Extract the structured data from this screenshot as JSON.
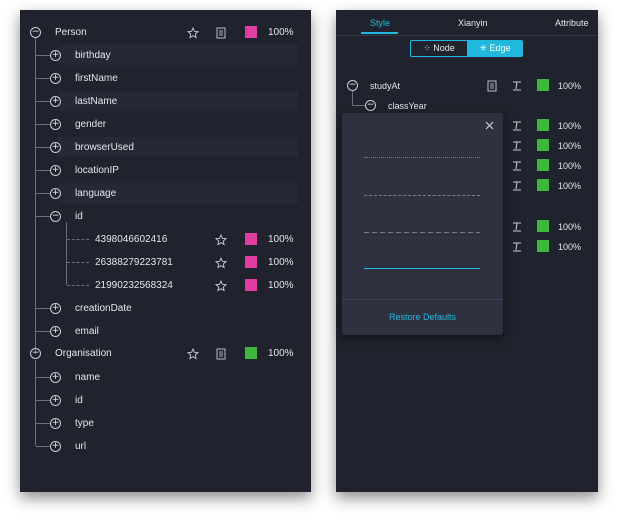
{
  "colors": {
    "accent": "#20b8dd",
    "pink": "#e13ea3",
    "green": "#3eb83c"
  },
  "left_tree": {
    "person": {
      "label": "Person",
      "percent": "100%",
      "color": "#e13ea3",
      "icons": [
        "star-icon",
        "document-icon"
      ]
    },
    "person_children": [
      "birthday",
      "firstName",
      "lastName",
      "gender",
      "browserUsed",
      "locationIP",
      "language",
      "id"
    ],
    "id_values": [
      {
        "value": "4398046602416",
        "percent": "100%",
        "color": "#e13ea3"
      },
      {
        "value": "26388279223781",
        "percent": "100%",
        "color": "#e13ea3"
      },
      {
        "value": "21990232568324",
        "percent": "100%",
        "color": "#e13ea3"
      }
    ],
    "person_children_after": [
      "creationDate",
      "email"
    ],
    "organisation": {
      "label": "Organisation",
      "percent": "100%",
      "color": "#3eb83c"
    },
    "organisation_children": [
      "name",
      "id",
      "type",
      "url"
    ]
  },
  "right_panel": {
    "tabs": [
      "Style",
      "Xianyin",
      "Attribute"
    ],
    "active_tab": "Style",
    "toggle": {
      "node_label": "Node",
      "edge_label": "Edge",
      "active": "Edge"
    },
    "edge_tree": {
      "root": {
        "label": "studyAt",
        "percent": "100%",
        "color": "#3eb83c"
      },
      "child": {
        "label": "classYear"
      },
      "rows": [
        {
          "percent": "100%",
          "color": "#3eb83c"
        },
        {
          "percent": "100%",
          "color": "#3eb83c"
        },
        {
          "percent": "100%",
          "color": "#3eb83c"
        },
        {
          "percent": "100%",
          "color": "#3eb83c"
        },
        {
          "percent": "100%",
          "color": "#3eb83c"
        },
        {
          "percent": "100%",
          "color": "#3eb83c"
        }
      ]
    },
    "popover": {
      "line_styles": [
        "dotted",
        "dashed-short",
        "dashed-long",
        "solid"
      ],
      "selected_line_style": "solid",
      "restore_label": "Restore Defaults"
    }
  }
}
